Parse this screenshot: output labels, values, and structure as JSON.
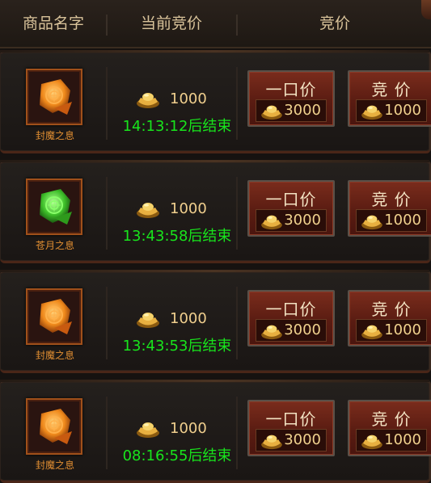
{
  "header": {
    "col_name": "商品名字",
    "col_price": "当前竞价",
    "col_bid": "竞价"
  },
  "rows": [
    {
      "item": "封魔之息",
      "item_color": "orange",
      "price": "1000",
      "timer": "14:13:12后结束",
      "buyout_label": "一口价",
      "buyout_price": "3000",
      "bid_label": "竞 价",
      "bid_price": "1000"
    },
    {
      "item": "苍月之息",
      "item_color": "green",
      "price": "1000",
      "timer": "13:43:58后结束",
      "buyout_label": "一口价",
      "buyout_price": "3000",
      "bid_label": "竞 价",
      "bid_price": "1000"
    },
    {
      "item": "封魔之息",
      "item_color": "orange",
      "price": "1000",
      "timer": "13:43:53后结束",
      "buyout_label": "一口价",
      "buyout_price": "3000",
      "bid_label": "竞 价",
      "bid_price": "1000"
    },
    {
      "item": "封魔之息",
      "item_color": "orange",
      "price": "1000",
      "timer": "08:16:55后结束",
      "buyout_label": "一口价",
      "buyout_price": "3000",
      "bid_label": "竞 价",
      "bid_price": "1000"
    }
  ],
  "icons": {
    "currency": "gold-ingot-icon",
    "item": "gem-stone-icon"
  },
  "colors": {
    "timer": "#18e41c",
    "price": "#f0cf8e",
    "item_name": "#e08e32",
    "header_text": "#d9c39a"
  }
}
